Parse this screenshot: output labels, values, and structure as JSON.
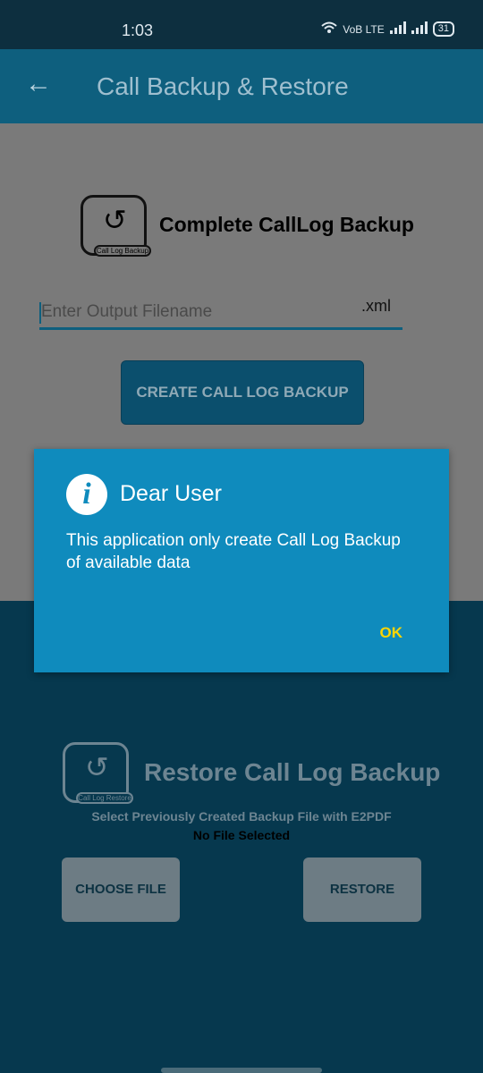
{
  "status_bar": {
    "time": "1:03",
    "network": "VoB LTE",
    "battery": "31"
  },
  "app_bar": {
    "back_icon": "back-arrow-icon",
    "title": "Call Backup & Restore"
  },
  "backup_section": {
    "logo_label": "Call Log Backup",
    "heading": "Complete CallLog Backup",
    "filename_placeholder": "Enter Output Filename",
    "extension": ".xml",
    "create_button": "CREATE CALL LOG BACKUP"
  },
  "restore_section": {
    "logo_label": "Call Log Restore",
    "heading": "Restore Call Log Backup",
    "instruction": "Select Previously Created Backup File with E2PDF",
    "file_status": "No File Selected",
    "choose_button": "CHOOSE FILE",
    "restore_button": "RESTORE"
  },
  "dialog": {
    "icon": "info-icon",
    "title": "Dear User",
    "message": "This application only create Call Log Backup of available data",
    "ok_button": "OK"
  },
  "colors": {
    "app_bar": "#0e5f7e",
    "dialog": "#0f8bbd",
    "ok_text": "#ffd500"
  }
}
